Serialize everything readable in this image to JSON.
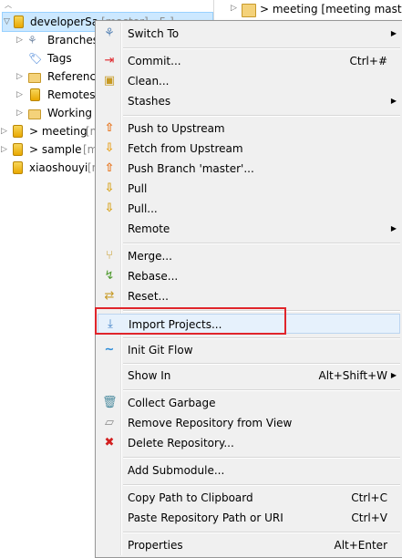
{
  "tree": {
    "items": [
      {
        "label": "developerSa",
        "suffix": "[master] - 5 ]",
        "icon": "repository-icon",
        "arrow": "▽",
        "selected": true
      },
      {
        "label": "Branches",
        "icon": "branches-icon",
        "arrow": "▷",
        "indent": 1
      },
      {
        "label": "Tags",
        "icon": "tag-icon",
        "arrow": "",
        "indent": 1
      },
      {
        "label": "Referenc",
        "icon": "folder-icon",
        "arrow": "▷",
        "indent": 1
      },
      {
        "label": "Remotes",
        "icon": "remotes-icon",
        "arrow": "▷",
        "indent": 1
      },
      {
        "label": "Working",
        "icon": "folder-icon",
        "arrow": "▷",
        "indent": 1
      },
      {
        "label": "> meeting",
        "suffix": "[m",
        "icon": "repository-icon",
        "arrow": "▷"
      },
      {
        "label": "> sample",
        "suffix": "[m",
        "icon": "repository-icon",
        "arrow": "▷"
      },
      {
        "label": "xiaoshouyi",
        "suffix": "[m",
        "icon": "repository-icon",
        "arrow": ""
      }
    ]
  },
  "right_pane": {
    "label": "> meeting [meeting maste"
  },
  "menu": {
    "items": [
      {
        "label": "Switch To",
        "shortcut": "",
        "submenu": true,
        "icon": "switch-icon"
      },
      {
        "label": "Commit...",
        "shortcut": "Ctrl+#",
        "submenu": false,
        "icon": "commit-icon"
      },
      {
        "label": "Clean...",
        "shortcut": "",
        "submenu": false,
        "icon": "clean-icon"
      },
      {
        "label": "Stashes",
        "shortcut": "",
        "submenu": true,
        "icon": ""
      },
      {
        "label": "Push to Upstream",
        "shortcut": "",
        "submenu": false,
        "icon": "push-icon"
      },
      {
        "label": "Fetch from Upstream",
        "shortcut": "",
        "submenu": false,
        "icon": "fetch-icon"
      },
      {
        "label": "Push Branch 'master'...",
        "shortcut": "",
        "submenu": false,
        "icon": "push-branch-icon"
      },
      {
        "label": "Pull",
        "shortcut": "",
        "submenu": false,
        "icon": "pull-icon"
      },
      {
        "label": "Pull...",
        "shortcut": "",
        "submenu": false,
        "icon": "pull-dialog-icon"
      },
      {
        "label": "Remote",
        "shortcut": "",
        "submenu": true,
        "icon": ""
      },
      {
        "label": "Merge...",
        "shortcut": "",
        "submenu": false,
        "icon": "merge-icon"
      },
      {
        "label": "Rebase...",
        "shortcut": "",
        "submenu": false,
        "icon": "rebase-icon"
      },
      {
        "label": "Reset...",
        "shortcut": "",
        "submenu": false,
        "icon": "reset-icon"
      },
      {
        "label": "Import Projects...",
        "shortcut": "",
        "submenu": false,
        "icon": "import-icon",
        "highlighted": true
      },
      {
        "label": "Init Git Flow",
        "shortcut": "",
        "submenu": false,
        "icon": "git-flow-icon"
      },
      {
        "label": "Show In",
        "shortcut": "Alt+Shift+W",
        "submenu": true,
        "icon": ""
      },
      {
        "label": "Collect Garbage",
        "shortcut": "",
        "submenu": false,
        "icon": "trash-icon"
      },
      {
        "label": "Remove Repository from View",
        "shortcut": "",
        "submenu": false,
        "icon": "eraser-icon"
      },
      {
        "label": "Delete Repository...",
        "shortcut": "",
        "submenu": false,
        "icon": "delete-icon"
      },
      {
        "label": "Add Submodule...",
        "shortcut": "",
        "submenu": false,
        "icon": ""
      },
      {
        "label": "Copy Path to Clipboard",
        "shortcut": "Ctrl+C",
        "submenu": false,
        "icon": ""
      },
      {
        "label": "Paste Repository Path or URI",
        "shortcut": "Ctrl+V",
        "submenu": false,
        "icon": ""
      },
      {
        "label": "Properties",
        "shortcut": "Alt+Enter",
        "submenu": false,
        "icon": ""
      }
    ]
  },
  "colors": {
    "highlight_box": "#e0252b",
    "menu_bg": "#f0f0f0",
    "selection": "#cce8ff"
  }
}
